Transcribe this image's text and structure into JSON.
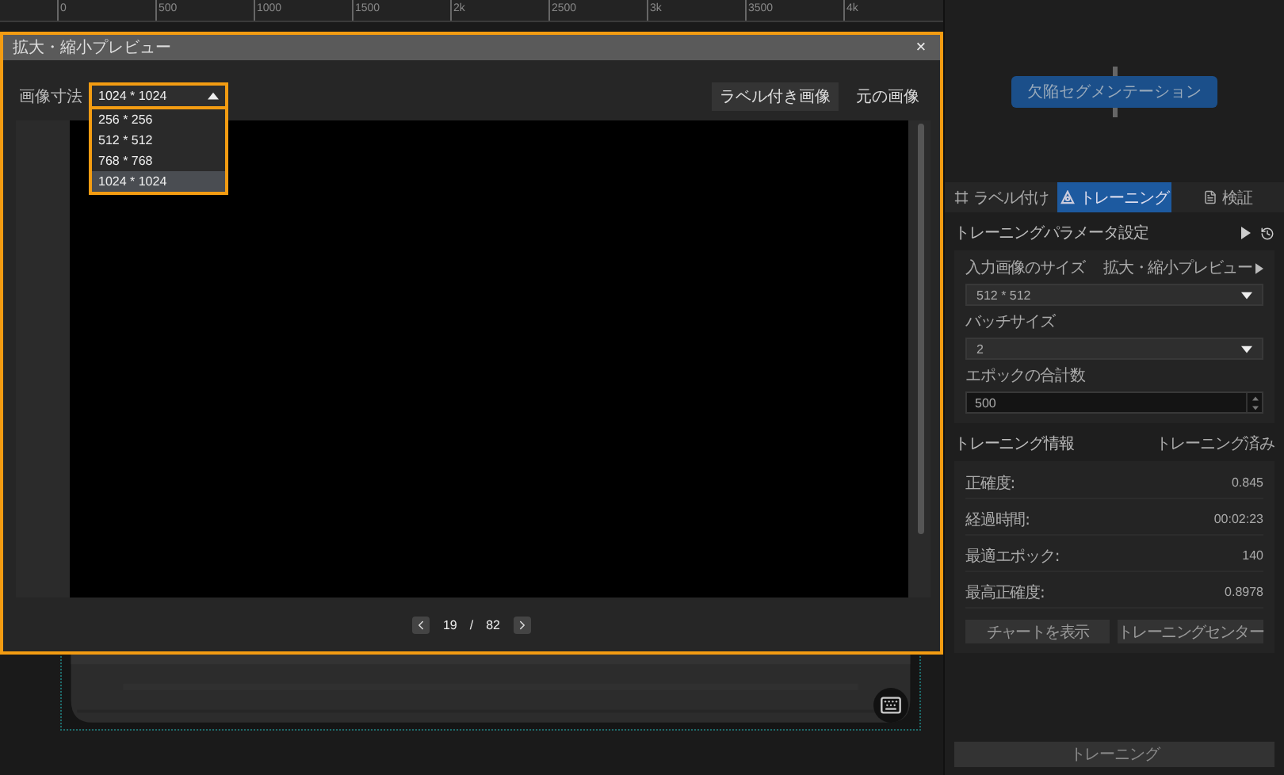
{
  "ruler": {
    "labels": [
      "0",
      "500",
      "1000",
      "1500",
      "2k",
      "2500",
      "3k",
      "3500",
      "4k"
    ]
  },
  "preview_dialog": {
    "title": "拡大・縮小プレビュー",
    "close": "×",
    "size_label": "画像寸法",
    "size_select": {
      "value": "1024 * 1024",
      "expanded": true,
      "options": [
        {
          "label": "256 * 256",
          "selected": false
        },
        {
          "label": "512 * 512",
          "selected": false
        },
        {
          "label": "768 * 768",
          "selected": false
        },
        {
          "label": "1024 * 1024",
          "selected": true
        }
      ]
    },
    "view_buttons": [
      {
        "label": "ラベル付き画像",
        "selected": true
      },
      {
        "label": "元の画像",
        "selected": false
      }
    ],
    "pagination": {
      "current": "19",
      "separator": "/",
      "total": "82"
    }
  },
  "side_panel": {
    "node": "欠陥セグメンテーション",
    "tabs": [
      {
        "label": "ラベル付け",
        "kind": "label",
        "selected": false
      },
      {
        "label": "トレーニング",
        "kind": "train",
        "selected": true
      },
      {
        "label": "検証",
        "kind": "verify",
        "selected": false
      }
    ],
    "params_title": "トレーニングパラメータ設定",
    "params": {
      "input_size_label": "入力画像のサイズ",
      "preview_link": "拡大・縮小プレビュー",
      "input_size": "512 * 512",
      "batch_label": "バッチサイズ",
      "batch": "2",
      "epochs_label": "エポックの合計数",
      "epochs": "500"
    },
    "info_title": "トレーニング情報",
    "info_status": "トレーニング済み",
    "info_rows": [
      {
        "label": "正確度:",
        "value": "0.845"
      },
      {
        "label": "経過時間:",
        "value": "00:02:23"
      },
      {
        "label": "最適エポック:",
        "value": "140"
      },
      {
        "label": "最高正確度:",
        "value": "0.8978"
      }
    ],
    "info_buttons": [
      "チャートを表示",
      "トレーニングセンター"
    ],
    "train_button": "トレーニング"
  }
}
